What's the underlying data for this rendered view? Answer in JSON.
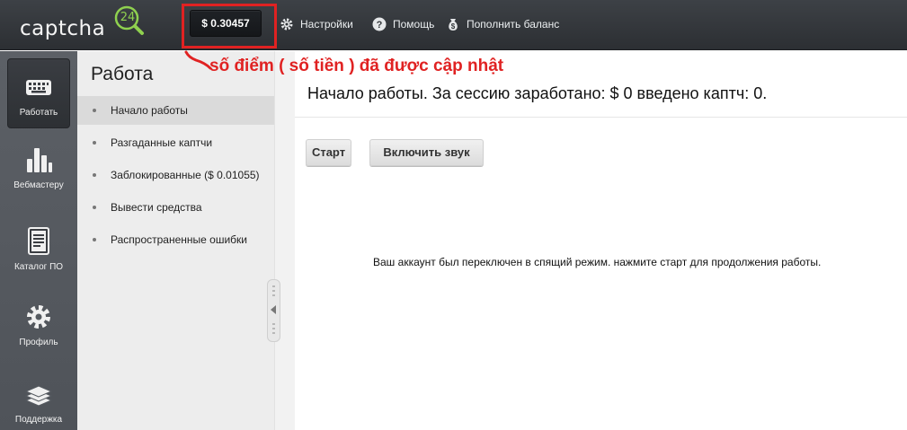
{
  "header": {
    "logo_text": "captcha",
    "logo_number": "24",
    "balance": "$ 0.30457",
    "nav": [
      {
        "label": "Настройки",
        "icon": "gear-icon"
      },
      {
        "label": "Помощь",
        "icon": "help-icon"
      },
      {
        "label": "Пополнить баланс",
        "icon": "money-bag-icon"
      }
    ]
  },
  "annotation": {
    "text": "số điểm ( số tiền ) đã được cập nhật",
    "color": "#e02222"
  },
  "rail": {
    "items": [
      {
        "label": "Работать",
        "icon": "keyboard-icon"
      },
      {
        "label": "Вебмастеру",
        "icon": "bar-chart-icon"
      },
      {
        "label": "Каталог ПО",
        "icon": "document-icon"
      },
      {
        "label": "Профиль",
        "icon": "gear-icon"
      },
      {
        "label": "Поддержка",
        "icon": "layers-icon"
      }
    ]
  },
  "submenu": {
    "title": "Работа",
    "items": [
      {
        "label": "Начало работы",
        "active": true
      },
      {
        "label": "Разгаданные каптчи"
      },
      {
        "label": "Заблокированные ($ 0.01055)"
      },
      {
        "label": "Вывести средства"
      },
      {
        "label": "Распространенные ошибки"
      }
    ]
  },
  "main": {
    "heading": "Начало работы. За сессию заработано: $ 0 введено каптч: 0.",
    "start_button": "Старт",
    "sound_button": "Включить звук",
    "status_message": "Ваш аккаунт был переключен в спящий режим. нажмите старт для продолжения работы."
  },
  "colors": {
    "accent_green": "#8fd14f",
    "topbar": "#34383c",
    "rail": "#555a60",
    "highlight_red": "#e02222"
  }
}
